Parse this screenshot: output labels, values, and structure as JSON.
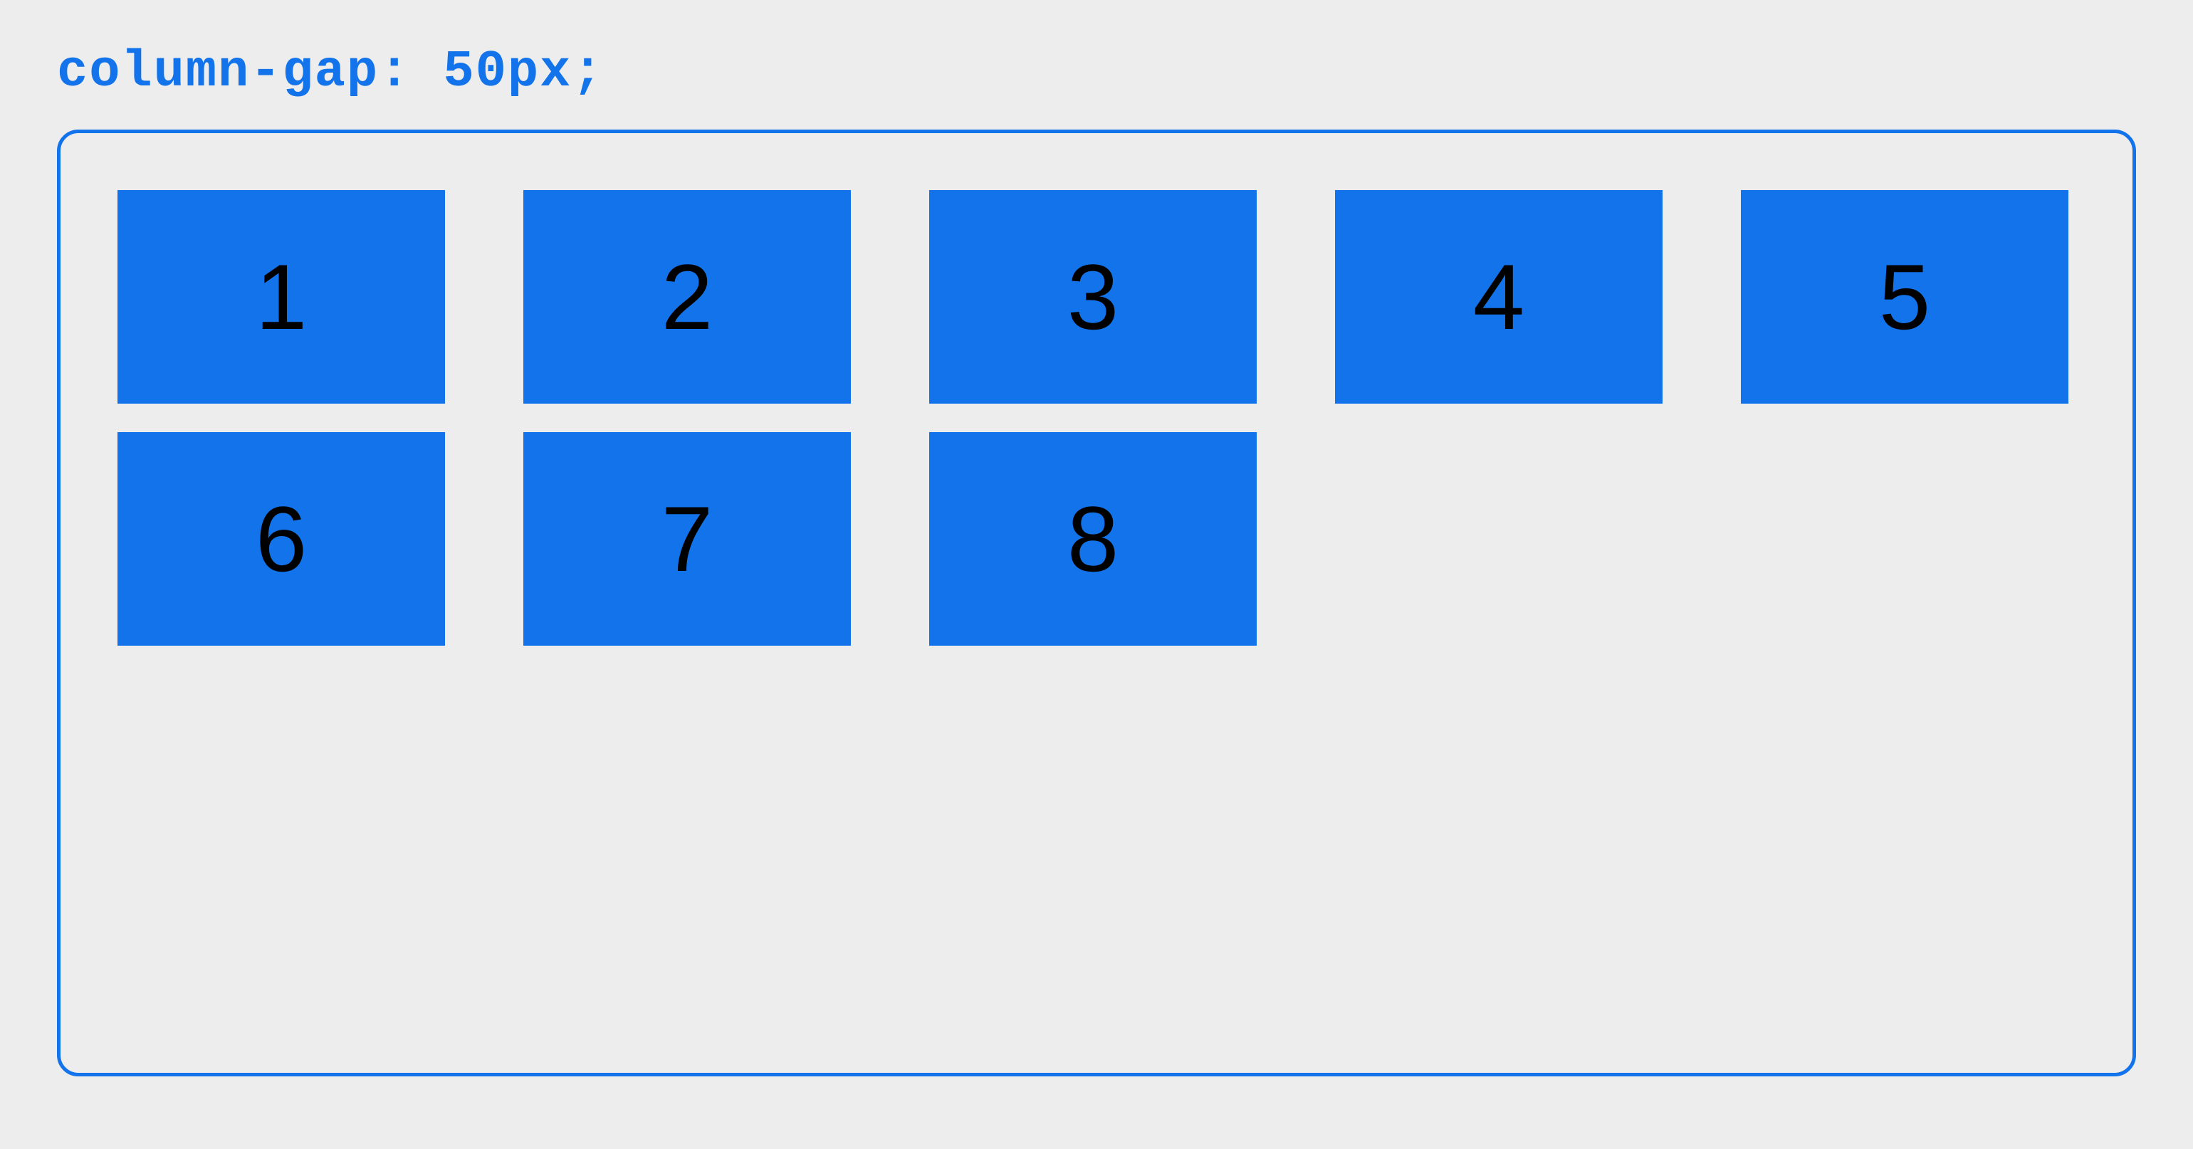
{
  "title": "column-gap: 50px;",
  "cells": [
    "1",
    "2",
    "3",
    "4",
    "5",
    "6",
    "7",
    "8"
  ]
}
